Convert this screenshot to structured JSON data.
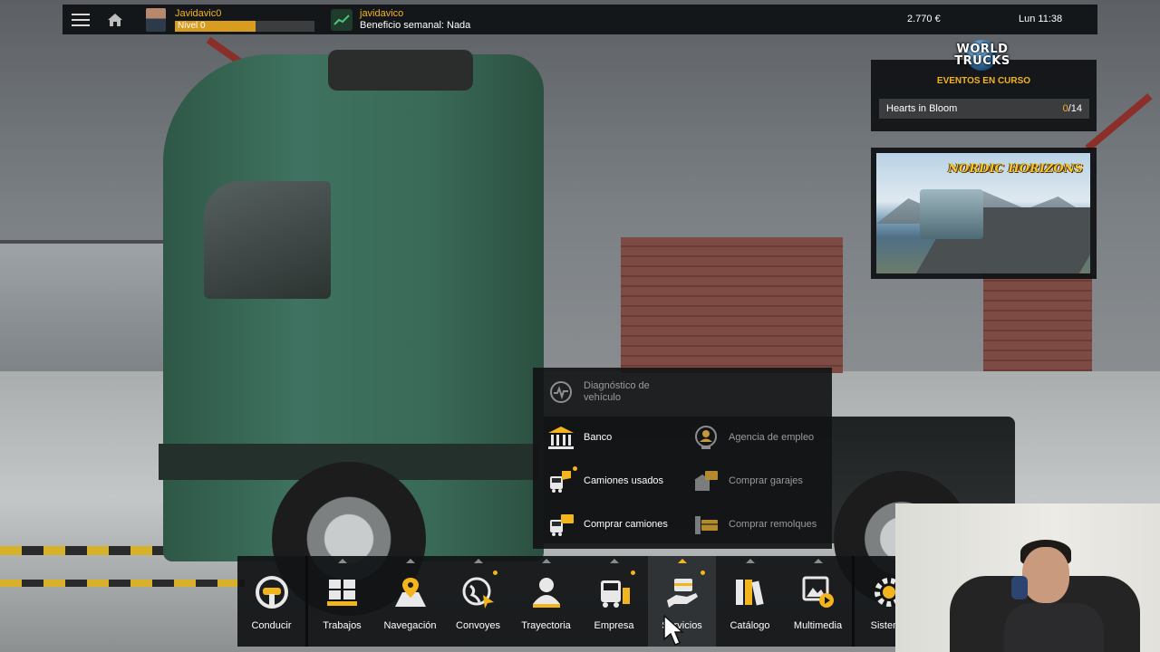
{
  "topbar": {
    "player_name": "Javidavic0",
    "level_label": "Nivel 0",
    "level_progress": 0.58,
    "company_name": "javidavico",
    "weekly_profit": "Beneficio semanal: Nada",
    "money": "2.770 €",
    "clock": "Lun 11:38"
  },
  "events": {
    "logo_line1": "WORLD",
    "logo_line2": "TRUCKS",
    "title": "EVENTOS EN CURSO",
    "event_name": "Hearts in Bloom",
    "progress_current": "0",
    "progress_total": "/14"
  },
  "banner": {
    "title": "NORDIC HORIZONS"
  },
  "services": {
    "items": [
      {
        "label": "Diagnóstico de vehículo",
        "icon": "diagnostics-icon"
      },
      {
        "label": "Banco",
        "icon": "bank-icon"
      },
      {
        "label": "Agencia de empleo",
        "icon": "recruitment-agency-icon"
      },
      {
        "label": "Camiones usados",
        "icon": "used-trucks-icon"
      },
      {
        "label": "Comprar garajes",
        "icon": "buy-garage-icon"
      },
      {
        "label": "Comprar camiones",
        "icon": "buy-trucks-icon"
      },
      {
        "label": "Comprar remolques",
        "icon": "buy-trailers-icon"
      }
    ]
  },
  "dock": {
    "items": [
      {
        "label": "Conducir",
        "icon": "steering-wheel-icon"
      },
      {
        "label": "Trabajos",
        "icon": "cargo-boxes-icon"
      },
      {
        "label": "Navegación",
        "icon": "map-pin-icon"
      },
      {
        "label": "Convoyes",
        "icon": "globe-icon"
      },
      {
        "label": "Trayectoria",
        "icon": "person-icon"
      },
      {
        "label": "Empresa",
        "icon": "truck-company-icon"
      },
      {
        "label": "Servicios",
        "icon": "services-hand-icon"
      },
      {
        "label": "Catálogo",
        "icon": "books-icon"
      },
      {
        "label": "Multimedia",
        "icon": "multimedia-icon"
      },
      {
        "label": "Sistema",
        "icon": "gear-icon"
      }
    ],
    "selected": "Servicios"
  },
  "colors": {
    "accent": "#f3b51d",
    "panel": "#0e1012",
    "level_fill": "#d89c1e"
  }
}
